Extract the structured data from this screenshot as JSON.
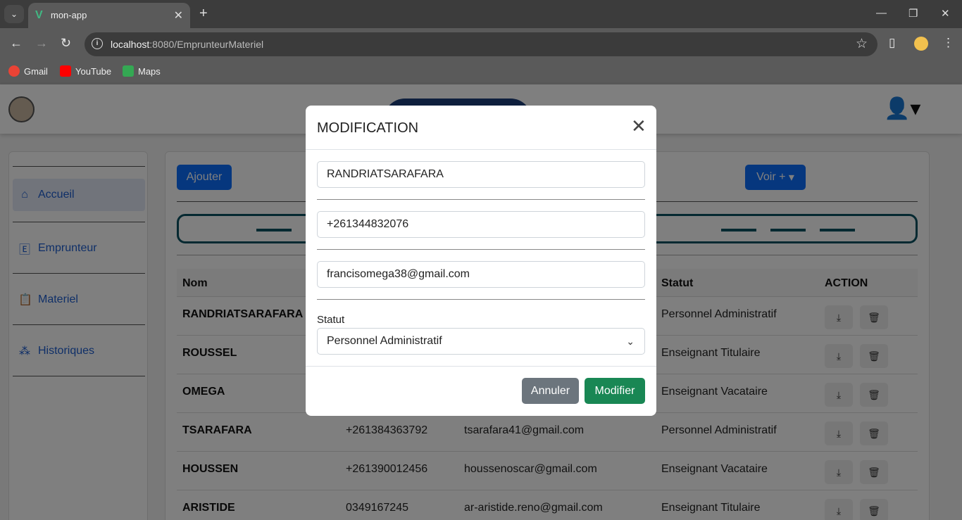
{
  "browser": {
    "tab_title": "mon-app",
    "url_host": "localhost",
    "url_rest": ":8080/EmprunteurMateriel",
    "bookmarks": [
      {
        "label": "Gmail",
        "color": "#ea4335"
      },
      {
        "label": "YouTube",
        "color": "#ff0000"
      },
      {
        "label": "Maps",
        "color": "#34a853"
      }
    ]
  },
  "colors": {
    "primary": "#0d6efd",
    "success": "#198754",
    "secondary": "#6c757d",
    "accent_border": "#0b5263"
  },
  "sidebar": {
    "items": [
      {
        "label": "Accueil",
        "icon": "home-icon",
        "active": true
      },
      {
        "label": "Emprunteur",
        "icon": "e-box-icon"
      },
      {
        "label": "Materiel",
        "icon": "clipboard-icon"
      },
      {
        "label": "Historiques",
        "icon": "hierarchy-icon"
      }
    ]
  },
  "main": {
    "add_button": "Ajouter",
    "more_button": "Voir +",
    "table": {
      "headers": {
        "nom": "Nom",
        "statut": "Statut",
        "action": "ACTION"
      },
      "rows": [
        {
          "nom": "RANDRIATSARAFARA",
          "tel": "",
          "email": "",
          "statut": "Personnel Administratif"
        },
        {
          "nom": "ROUSSEL",
          "tel": "",
          "email": "",
          "statut": "Enseignant Titulaire"
        },
        {
          "nom": "OMEGA",
          "tel": "",
          "email": "",
          "statut": "Enseignant Vacataire"
        },
        {
          "nom": "TSARAFARA",
          "tel": "+261384363792",
          "email": "tsarafara41@gmail.com",
          "statut": "Personnel Administratif"
        },
        {
          "nom": "HOUSSEN",
          "tel": "+261390012456",
          "email": "houssenoscar@gmail.com",
          "statut": "Enseignant Vacataire"
        },
        {
          "nom": "ARISTIDE",
          "tel": "0349167245",
          "email": "ar-aristide.reno@gmail.com",
          "statut": "Enseignant Titulaire"
        }
      ]
    }
  },
  "modal": {
    "title": "MODIFICATION",
    "nom_value": "RANDRIATSARAFARA",
    "tel_value": "+261344832076",
    "email_value": "francisomega38@gmail.com",
    "statut_label": "Statut",
    "statut_value": "Personnel Administratif",
    "cancel_label": "Annuler",
    "submit_label": "Modifier"
  }
}
